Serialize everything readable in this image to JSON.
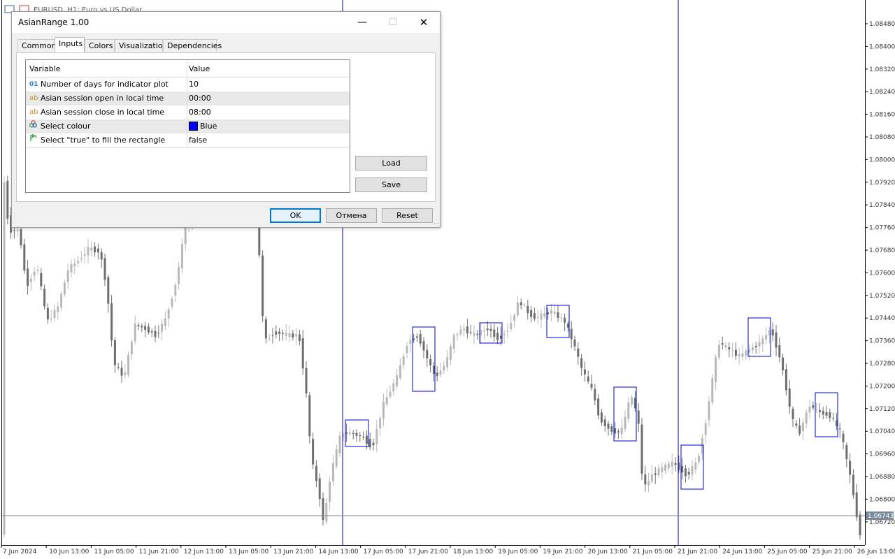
{
  "chart": {
    "title": "EURUSD, H1:  Euro vs US Dollar",
    "price_labels": [
      "1.08480",
      "1.08400",
      "1.08320",
      "1.08240",
      "1.08160",
      "1.08080",
      "1.08000",
      "1.07920",
      "1.07840",
      "1.07760",
      "1.07680",
      "1.07600",
      "1.07520",
      "1.07440",
      "1.07360",
      "1.07280",
      "1.07200",
      "1.07120",
      "1.07040",
      "1.06960",
      "1.06880",
      "1.06800",
      "1.06720"
    ],
    "current_price": "1.06743",
    "time_labels": [
      "7 Jun 2024",
      "10 Jun 13:00",
      "11 Jun 05:00",
      "11 Jun 21:00",
      "12 Jun 13:00",
      "13 Jun 05:00",
      "13 Jun 21:00",
      "14 Jun 13:00",
      "17 Jun 05:00",
      "17 Jun 21:00",
      "18 Jun 13:00",
      "19 Jun 05:00",
      "19 Jun 21:00",
      "20 Jun 13:00",
      "21 Jun 05:00",
      "21 Jun 21:00",
      "24 Jun 13:00",
      "25 Jun 05:00",
      "25 Jun 21:00",
      "26 Jun 13:00"
    ],
    "colors": {
      "candle_bull": "#b8b8b8",
      "candle_bear": "#6e6e6e",
      "rectangle": "#0000cc",
      "separator": "#0000cc",
      "price_line": "#7a8a9a"
    }
  },
  "dialog": {
    "title": "AsianRange 1.00",
    "tabs": [
      "Common",
      "Inputs",
      "Colors",
      "Visualization",
      "Dependencies"
    ],
    "active_tab": "Inputs",
    "columns": {
      "variable": "Variable",
      "value": "Value"
    },
    "rows": [
      {
        "icon": "01",
        "icon_name": "integer-icon",
        "variable": "Number of days for indicator plot",
        "value": "10"
      },
      {
        "icon": "ab",
        "icon_name": "string-icon",
        "variable": "Asian session open in local time",
        "value": "00:00"
      },
      {
        "icon": "ab",
        "icon_name": "string-icon",
        "variable": "Asian session close in local time",
        "value": "08:00"
      },
      {
        "icon": "",
        "icon_name": "color-icon",
        "variable": "Select colour",
        "value": "Blue"
      },
      {
        "icon": "",
        "icon_name": "bool-icon",
        "variable": "Select \"true\" to fill the rectangle",
        "value": "false"
      }
    ],
    "buttons": {
      "load": "Load",
      "save": "Save",
      "ok": "OK",
      "cancel": "Отмена",
      "reset": "Reset"
    }
  }
}
